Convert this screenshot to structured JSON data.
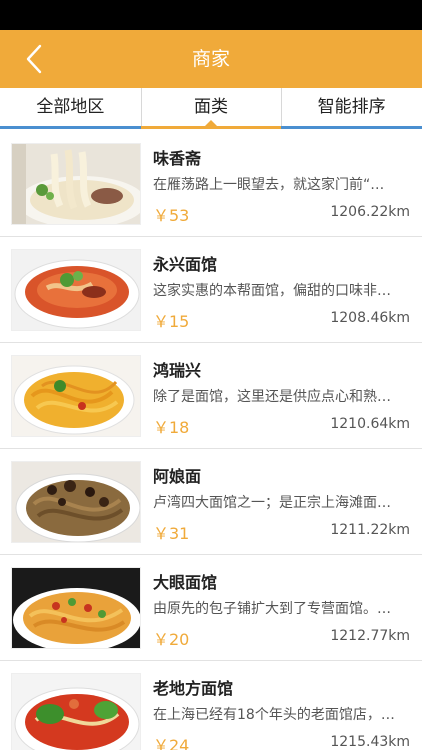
{
  "header": {
    "title": "商家",
    "back_icon": "chevron-left-icon",
    "bg_color": "#f0aa3a"
  },
  "tabs": [
    {
      "label": "全部地区",
      "active": false
    },
    {
      "label": "面类",
      "active": true
    },
    {
      "label": "智能排序",
      "active": false
    }
  ],
  "items": [
    {
      "name": "味香斋",
      "desc": "在雁荡路上一眼望去，就这家门前“…",
      "price": "￥53",
      "distance": "1206.22km"
    },
    {
      "name": "永兴面馆",
      "desc": "这家实惠的本帮面馆，偏甜的口味非…",
      "price": "￥15",
      "distance": "1208.46km"
    },
    {
      "name": "鸿瑞兴",
      "desc": "除了是面馆，这里还是供应点心和熟…",
      "price": "￥18",
      "distance": "1210.64km"
    },
    {
      "name": "阿娘面",
      "desc": "卢湾四大面馆之一；是正宗上海滩面…",
      "price": "￥31",
      "distance": "1211.22km"
    },
    {
      "name": "大眼面馆",
      "desc": "由原先的包子铺扩大到了专营面馆。…",
      "price": "￥20",
      "distance": "1212.77km"
    },
    {
      "name": "老地方面馆",
      "desc": "在上海已经有18个年头的老面馆店，…",
      "price": "￥24",
      "distance": "1215.43km"
    }
  ],
  "colors": {
    "accent": "#f0aa3a",
    "tab_underline": "#4a8fd0"
  }
}
